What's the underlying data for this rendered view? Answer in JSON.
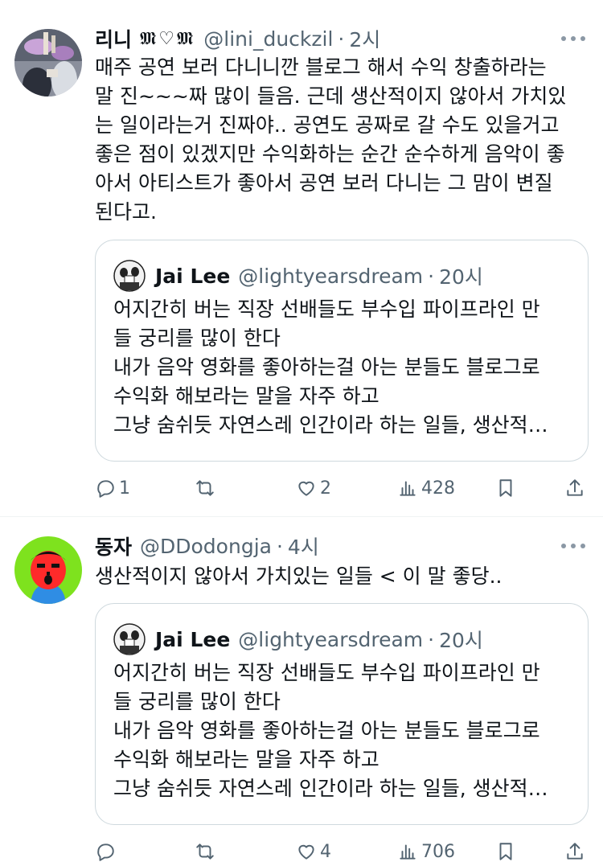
{
  "tweets": [
    {
      "author_name": "리니",
      "author_deco": "𝕸♡𝕸",
      "handle": "@lini_duckzil",
      "sep": "·",
      "time": "2시",
      "lines": [
        "매주 공연 보러 다니니깐 블로그 해서 수익 창출하라는",
        "말 진~~~짜 많이 들음. 근데 생산적이지 않아서 가치있",
        "는 일이라는거 진짜야.. 공연도 공짜로 갈 수도 있을거고",
        "좋은 점이 있겠지만 수익화하는 순간 순수하게 음악이 좋",
        "아서 아티스트가 좋아서 공연 보러 다니는 그 맘이 변질",
        "된다고."
      ],
      "quote": {
        "author_name": "Jai Lee",
        "handle": "@lightyearsdream",
        "sep": "·",
        "time": "20시",
        "lines": [
          "어지간히 버는 직장 선배들도 부수입 파이프라인 만",
          "들 궁리를 많이 한다",
          "내가 음악 영화를 좋아하는걸 아는 분들도 블로그로",
          "수익화 해보라는 말을 자주 하고",
          "그냥 숨쉬듯 자연스레 인간이라 하는 일들, 생산적…"
        ]
      },
      "actions": {
        "replies": "1",
        "retweets": "",
        "likes": "2",
        "views": "428"
      }
    },
    {
      "author_name": "동자",
      "handle": "@DDodongja",
      "sep": "·",
      "time": "4시",
      "lines": [
        "생산적이지 않아서 가치있는 일들 < 이 말 좋당.."
      ],
      "quote": {
        "author_name": "Jai Lee",
        "handle": "@lightyearsdream",
        "sep": "·",
        "time": "20시",
        "lines": [
          "어지간히 버는 직장 선배들도 부수입 파이프라인 만",
          "들 궁리를 많이 한다",
          "내가 음악 영화를 좋아하는걸 아는 분들도 블로그로",
          "수익화 해보라는 말을 자주 하고",
          "그냥 숨쉬듯 자연스레 인간이라 하는 일들, 생산적…"
        ]
      },
      "actions": {
        "replies": "",
        "retweets": "",
        "likes": "4",
        "views": "706"
      }
    }
  ],
  "colors": {
    "text": "#0f1419",
    "secondary": "#536471",
    "border": "#cfd9de",
    "avatar2_bg": "#7ee21e"
  },
  "icons": [
    "reply-icon",
    "retweet-icon",
    "like-icon",
    "views-icon",
    "bookmark-icon",
    "share-icon",
    "more-icon"
  ]
}
